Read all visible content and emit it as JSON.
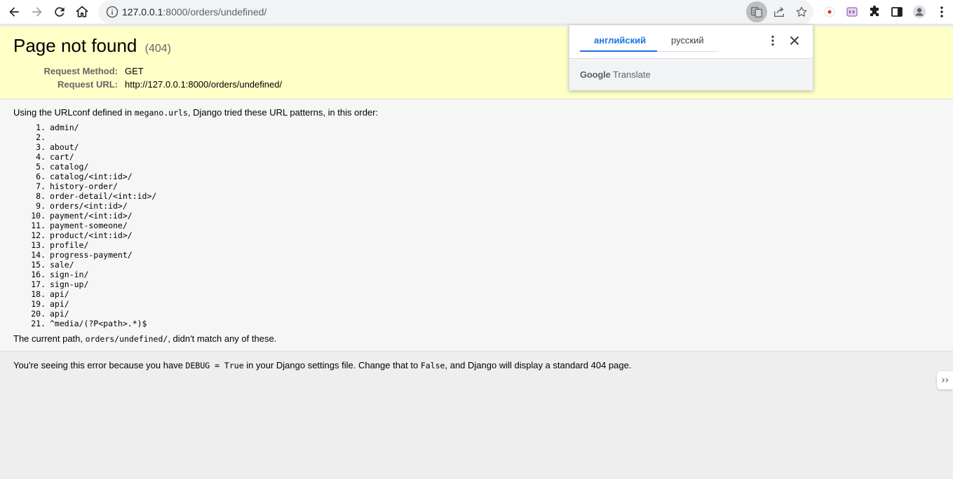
{
  "browser": {
    "url_host": "127.0.0.1",
    "url_path": ":8000/orders/undefined/",
    "colors": {
      "toolbar_bg": "#ffffff",
      "omnibox_bg": "#f1f3f4",
      "accent": "#1a73e8"
    },
    "icons": [
      "back-icon",
      "forward-icon",
      "reload-icon",
      "home-icon",
      "site-info-icon",
      "translate-icon",
      "share-icon",
      "bookmark-star-icon",
      "extension-record-icon",
      "extension-puzzle-icon",
      "side-panel-icon",
      "profile-icon",
      "menu-icon"
    ]
  },
  "error": {
    "title": "Page not found",
    "code": "(404)",
    "request_method_label": "Request Method:",
    "request_method": "GET",
    "request_url_label": "Request URL:",
    "request_url": "http://127.0.0.1:8000/orders/undefined/"
  },
  "info": {
    "intro_before": "Using the URLconf defined in ",
    "urlconf": "megano.urls",
    "intro_after": ", Django tried these URL patterns, in this order:",
    "patterns": [
      "admin/",
      "",
      "about/",
      "cart/",
      "catalog/",
      "catalog/<int:id>/",
      "history-order/",
      "order-detail/<int:id>/",
      "orders/<int:id>/",
      "payment/<int:id>/",
      "payment-someone/",
      "product/<int:id>/",
      "profile/",
      "progress-payment/",
      "sale/",
      "sign-in/",
      "sign-up/",
      "api/",
      "api/",
      "api/",
      "^media/(?P<path>.*)$"
    ],
    "outro_before": "The current path, ",
    "current_path": "orders/undefined/",
    "outro_after": ", didn't match any of these."
  },
  "explanation": {
    "before": "You're seeing this error because you have ",
    "debug_code": "DEBUG = True",
    "middle": " in your Django settings file. Change that to ",
    "false_code": "False",
    "after": ", and Django will display a standard 404 page."
  },
  "translate_popup": {
    "tab_source": "английский",
    "tab_target": "русский",
    "brand_google": "Google",
    "brand_translate": "Translate"
  }
}
